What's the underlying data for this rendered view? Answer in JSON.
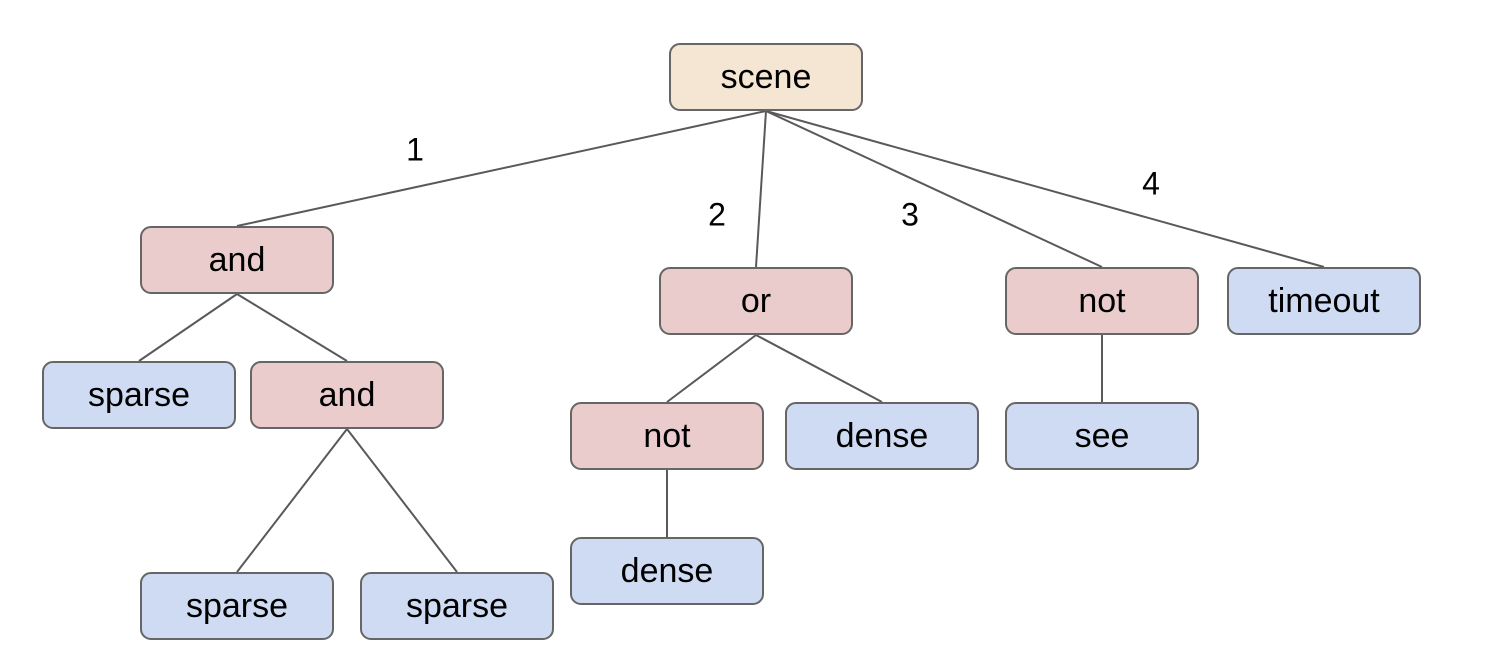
{
  "colors": {
    "root": "#f5e6d3",
    "operator": "#e9cccb",
    "leaf": "#cfdbf2",
    "edge": "#595959",
    "border": "#666666"
  },
  "nodes": [
    {
      "id": "scene",
      "label": "scene",
      "kind": "root"
    },
    {
      "id": "and1",
      "label": "and",
      "kind": "op",
      "parent": "scene",
      "edge_label": "1"
    },
    {
      "id": "sparse1",
      "label": "sparse",
      "kind": "leaf",
      "parent": "and1"
    },
    {
      "id": "and2",
      "label": "and",
      "kind": "op",
      "parent": "and1"
    },
    {
      "id": "sparse2",
      "label": "sparse",
      "kind": "leaf",
      "parent": "and2"
    },
    {
      "id": "sparse3",
      "label": "sparse",
      "kind": "leaf",
      "parent": "and2"
    },
    {
      "id": "or1",
      "label": "or",
      "kind": "op",
      "parent": "scene",
      "edge_label": "2"
    },
    {
      "id": "not1",
      "label": "not",
      "kind": "op",
      "parent": "or1"
    },
    {
      "id": "dense1",
      "label": "dense",
      "kind": "leaf",
      "parent": "not1"
    },
    {
      "id": "dense2",
      "label": "dense",
      "kind": "leaf",
      "parent": "or1"
    },
    {
      "id": "not2",
      "label": "not",
      "kind": "op",
      "parent": "scene",
      "edge_label": "3"
    },
    {
      "id": "see1",
      "label": "see",
      "kind": "leaf",
      "parent": "not2"
    },
    {
      "id": "timeout1",
      "label": "timeout",
      "kind": "leaf",
      "parent": "scene",
      "edge_label": "4"
    }
  ]
}
